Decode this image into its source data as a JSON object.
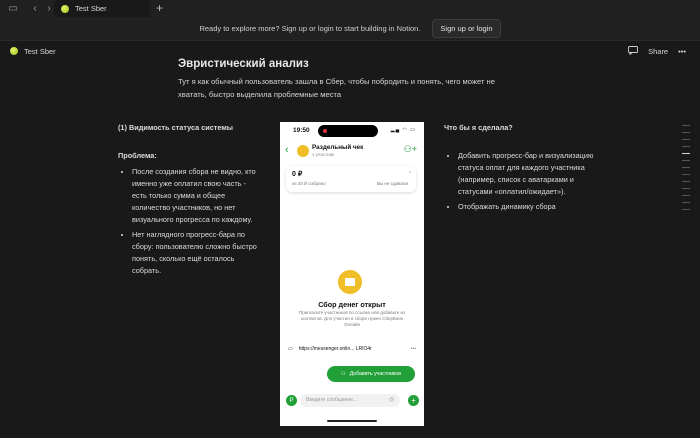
{
  "browser": {
    "tab_title": "Test Sber",
    "sidebar_icon": "sidebar-toggle-icon",
    "back_icon": "back-arrow-icon",
    "forward_icon": "forward-arrow-icon",
    "new_tab_icon": "plus-icon"
  },
  "banner": {
    "message": "Ready to explore more? Sign up or login to start building in Notion.",
    "button_label": "Sign up or login"
  },
  "page_header": {
    "breadcrumb": "Test Sber",
    "share_label": "Share"
  },
  "content": {
    "heading": "Эвристический анализ",
    "intro": "Тут я как обычный пользователь зашла в Сбер, чтобы побродить и понять, чего может не хватать, быстро выделила проблемные места",
    "left": {
      "section_title": "(1) Видимость статуса системы",
      "problem_label": "Проблема:",
      "bullets": [
        "После создания сбора не видно, кто именно уже оплатил свою часть - есть только сумма и общее количество участников, но нет визуального прогресса по каждому.",
        "Нет наглядного прогресс-бара по сбору: пользователю сложно быстро понять, сколько ещё осталось собрать."
      ]
    },
    "right": {
      "section_title": "Что бы я сделала?",
      "bullets": [
        "Добавить прогресс-бар и визуализацию статуса оплат для каждого участника (например, список с аватарками и статусами «оплатил/ожидает»).",
        "Отображать динамику сбора"
      ]
    }
  },
  "phone": {
    "time": "19:50",
    "chat_title": "Раздельный чек",
    "chat_subtitle": "1 участник",
    "amount": "0 ₽",
    "amount_of": "из 20 ₽ собрано",
    "who_paid": "Вы не сдавали",
    "open_title": "Сбор денег открыт",
    "open_desc": "Пригласите участников по ссылке или добавьте из контактов. Для участия в сборе нужен СберБанк Онлайн",
    "link": "https://messenger.onlin... LRIO4r",
    "add_button": "Добавить участников",
    "composer_placeholder": "Введите сообщение...",
    "composer_badge": "Р"
  },
  "colors": {
    "background": "#191919",
    "accent_green": "#21a038",
    "coin_yellow": "#f0be26"
  }
}
